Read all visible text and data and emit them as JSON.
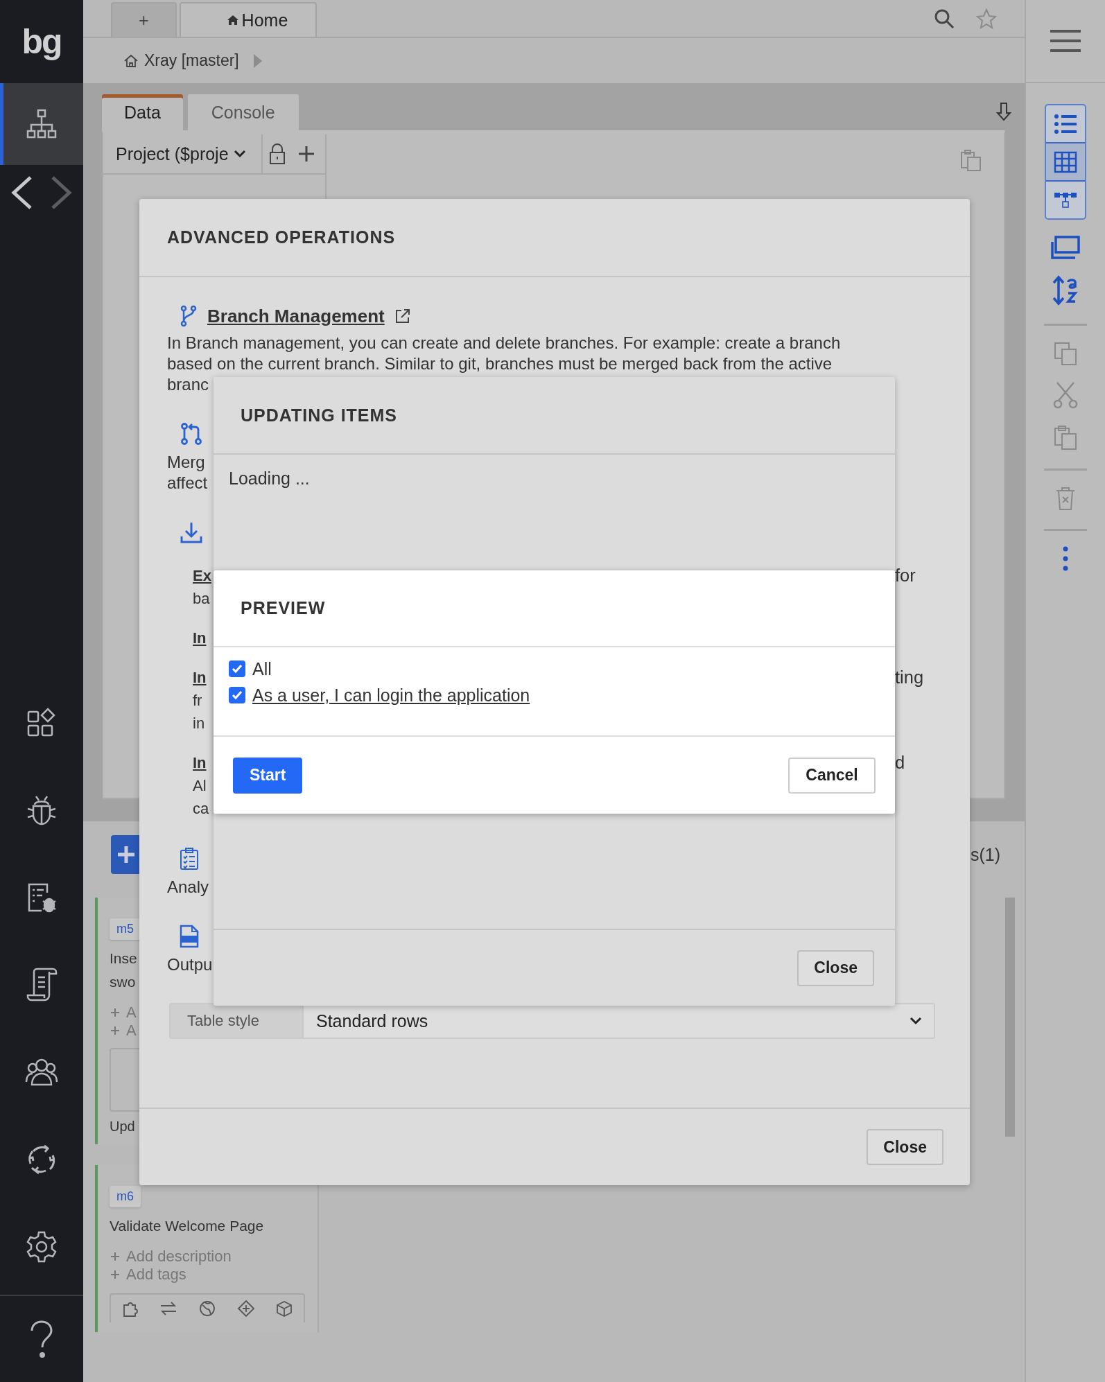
{
  "nav": {
    "logo": "bg",
    "items": [
      {
        "selected": true
      },
      {
        "selected": false
      },
      {
        "selected": false
      },
      {
        "selected": false
      },
      {
        "selected": false
      },
      {
        "selected": false
      },
      {
        "selected": false
      },
      {
        "selected": false
      }
    ]
  },
  "tabs": [
    {
      "label": "+",
      "selected": false
    },
    {
      "label": "Home",
      "selected": true
    }
  ],
  "breadcrumb": {
    "label": "Xray [master]"
  },
  "panel_tabs": [
    {
      "label": "Data",
      "selected": true
    },
    {
      "label": "Console",
      "selected": false
    }
  ],
  "project_select": {
    "value": "Project ($proje"
  },
  "lower": {
    "tab_fragment": "s(1)"
  },
  "cards": [
    {
      "tag": "m5",
      "title_lines": [
        "Inse",
        "swo"
      ],
      "actions": [
        "A",
        "A"
      ],
      "footer": "Upd"
    },
    {
      "tag": "m6",
      "title_lines": [
        "Validate Welcome Page"
      ],
      "actions": [
        "Add description",
        "Add tags"
      ]
    }
  ],
  "right_toolbar": {
    "views": [
      {
        "selected": false
      },
      {
        "selected": true
      },
      {
        "selected": false
      }
    ]
  },
  "advanced": {
    "title": "ADVANCED OPERATIONS",
    "rows": [
      {
        "kind": "heading",
        "link": "Branch Management"
      },
      {
        "kind": "text",
        "left": "In Branch management, you can create and delete branches. For example: create a branch"
      },
      {
        "kind": "text",
        "left": "based on the current branch. Similar to git, branches must be merged back from the active"
      },
      {
        "kind": "text",
        "left": "branc"
      },
      {
        "kind": "heading"
      },
      {
        "kind": "text",
        "left": "Merg"
      },
      {
        "kind": "text",
        "left": "affect"
      },
      {
        "kind": "heading"
      },
      {
        "kind": "sub-link",
        "left": "Ex",
        "right": "for"
      },
      {
        "kind": "sub-text",
        "left": "ba"
      },
      {
        "kind": "sub-link",
        "left": "In"
      },
      {
        "kind": "sub-link",
        "left": "In",
        "right": "ting"
      },
      {
        "kind": "sub-text",
        "left": "fr"
      },
      {
        "kind": "sub-text",
        "left": "in"
      },
      {
        "kind": "sub-link",
        "left": "In",
        "right": "d"
      },
      {
        "kind": "sub-text",
        "left": "Al"
      },
      {
        "kind": "sub-text",
        "left": "ca"
      },
      {
        "kind": "heading"
      },
      {
        "kind": "text",
        "left": "Analy"
      },
      {
        "kind": "heading"
      },
      {
        "kind": "text",
        "left": "Outpu"
      }
    ],
    "table_style": {
      "label": "Table style",
      "value": "Standard rows"
    },
    "close": "Close"
  },
  "updating": {
    "title": "UPDATING ITEMS",
    "status": "Loading ...",
    "close": "Close"
  },
  "preview": {
    "title": "PREVIEW",
    "items": [
      {
        "label": "All",
        "checked": true,
        "kind": "plain"
      },
      {
        "label": "As a user, I can login the application",
        "checked": true,
        "kind": "link"
      }
    ],
    "start": "Start",
    "cancel": "Cancel"
  }
}
